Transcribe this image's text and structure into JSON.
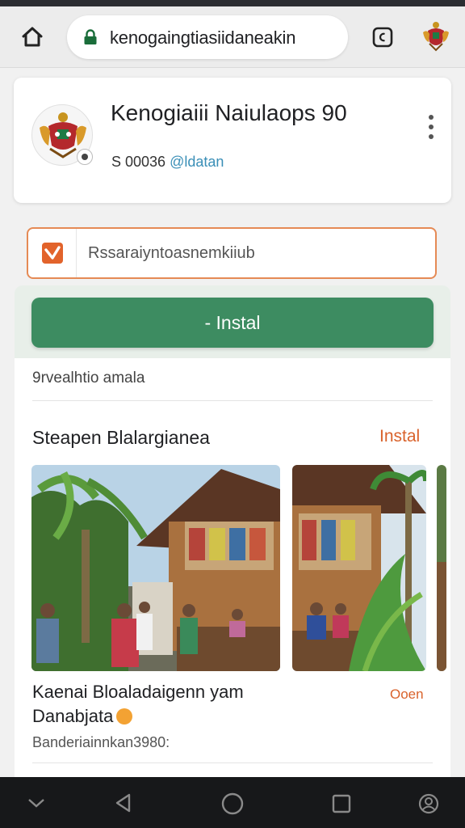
{
  "browser": {
    "url": "kenogaingtiasiidaneakin",
    "accent": "#1a6d3a"
  },
  "icons": {
    "home": "home-icon",
    "lock": "lock-icon",
    "tabs": "tabs-icon",
    "crest": "crest-icon",
    "menu": "more-vert-icon",
    "search": "brand-m-icon"
  },
  "profile": {
    "name": "Kenogiaiii Naiulaops 90",
    "count": "S 00036",
    "handle": "@ldatan"
  },
  "search": {
    "placeholder": "Rssaraiyntoasnemkiiub"
  },
  "install": {
    "label": "- Instal",
    "color": "#3d8c61"
  },
  "meta": {
    "text": "9rvealhtio amala"
  },
  "section": {
    "title": "Steapen Blalargianea",
    "action": "Instal"
  },
  "card": {
    "title_line1": "Kaenai Bloaladaigenn yam",
    "title_line2": "Danabjata",
    "tag": "Ooen",
    "subtitle": "Banderiainnkan3980:"
  },
  "navbar": {
    "items": [
      "chevron-down-icon",
      "back-icon",
      "home-circle-icon",
      "recents-icon",
      "accessibility-icon"
    ]
  }
}
